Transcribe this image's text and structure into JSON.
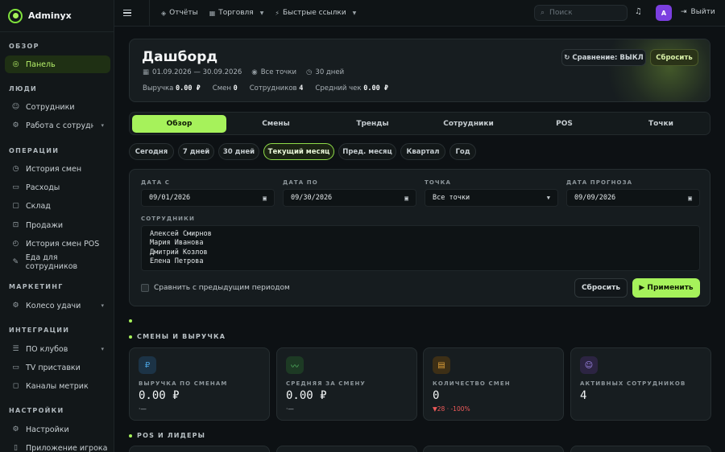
{
  "app": {
    "name": "Adminyx"
  },
  "sidebar": {
    "sections": [
      {
        "title": "ОБЗОР",
        "items": [
          {
            "label": "Панель",
            "icon": "dashboard-icon",
            "active": true
          }
        ]
      },
      {
        "title": "ЛЮДИ",
        "items": [
          {
            "label": "Сотрудники",
            "icon": "users-icon"
          },
          {
            "label": "Работа с сотрудниками",
            "icon": "briefcase-icon",
            "expandable": true
          }
        ]
      },
      {
        "title": "ОПЕРАЦИИ",
        "items": [
          {
            "label": "История смен",
            "icon": "clock-icon"
          },
          {
            "label": "Расходы",
            "icon": "wallet-icon"
          },
          {
            "label": "Склад",
            "icon": "box-icon"
          },
          {
            "label": "Продажи",
            "icon": "cart-icon"
          },
          {
            "label": "История смен POS",
            "icon": "history-icon"
          },
          {
            "label": "Еда для сотрудников",
            "icon": "food-icon"
          }
        ]
      },
      {
        "title": "МАРКЕТИНГ",
        "items": [
          {
            "label": "Колесо удачи",
            "icon": "wheel-icon",
            "expandable": true
          }
        ]
      },
      {
        "title": "ИНТЕГРАЦИИ",
        "items": [
          {
            "label": "ПО клубов",
            "icon": "software-icon",
            "expandable": true
          },
          {
            "label": "TV приставки",
            "icon": "tv-icon"
          },
          {
            "label": "Каналы метрик",
            "icon": "channel-icon"
          }
        ]
      },
      {
        "title": "НАСТРОЙКИ",
        "items": [
          {
            "label": "Настройки",
            "icon": "gear-icon"
          },
          {
            "label": "Приложение игрока",
            "icon": "phone-icon"
          }
        ]
      }
    ]
  },
  "topbar": {
    "links": [
      {
        "label": "Отчёты",
        "icon": "report-icon"
      },
      {
        "label": "Торговля",
        "icon": "trade-icon",
        "dropdown": true
      },
      {
        "label": "Быстрые ссылки",
        "icon": "bolt-icon",
        "dropdown": true
      }
    ],
    "search_placeholder": "Поиск",
    "avatar_letter": "A",
    "logout_label": "Выйти"
  },
  "hero": {
    "title": "Дашборд",
    "date_range": "01.09.2026 — 30.09.2026",
    "location": "Все точки",
    "duration": "30 дней",
    "stats": [
      {
        "label": "Выручка",
        "value": "0.00 ₽"
      },
      {
        "label": "Смен",
        "value": "0"
      },
      {
        "label": "Сотрудников",
        "value": "4"
      },
      {
        "label": "Средний чек",
        "value": "0.00 ₽"
      }
    ],
    "compare_label": "↻ Сравнение: ВЫКЛ",
    "reset_label": "Сбросить"
  },
  "tabs": [
    {
      "label": "Обзор",
      "active": true
    },
    {
      "label": "Смены"
    },
    {
      "label": "Тренды"
    },
    {
      "label": "Сотрудники"
    },
    {
      "label": "POS"
    },
    {
      "label": "Точки"
    }
  ],
  "periods": [
    {
      "label": "Сегодня"
    },
    {
      "label": "7 дней"
    },
    {
      "label": "30 дней"
    },
    {
      "label": "Текущий месяц",
      "active": true
    },
    {
      "label": "Пред. месяц"
    },
    {
      "label": "Квартал"
    },
    {
      "label": "Год"
    }
  ],
  "filters": {
    "date_from": {
      "label": "ДАТА С",
      "value": "09/01/2026"
    },
    "date_to": {
      "label": "ДАТА ПО",
      "value": "09/30/2026"
    },
    "point": {
      "label": "ТОЧКА",
      "value": "Все точки"
    },
    "forecast": {
      "label": "ДАТА ПРОГНОЗА",
      "value": "09/09/2026"
    },
    "employees": {
      "label": "СОТРУДНИКИ",
      "options": [
        "Алексей Смирнов",
        "Мария Иванова",
        "Дмитрий Козлов",
        "Елена Петрова"
      ]
    },
    "compare_checkbox": "Сравнить с предыдущим периодом",
    "reset_label": "Сбросить",
    "apply_label": "▶ Применить"
  },
  "section_shifts": {
    "title": "СМЕНЫ И ВЫРУЧКА"
  },
  "kpis": [
    {
      "label": "ВЫРУЧКА ПО СМЕНАМ",
      "value": "0.00 ₽",
      "delta": "·—",
      "icon": "ruble-icon",
      "color": "#4aa3e0"
    },
    {
      "label": "СРЕДНЯЯ ЗА СМЕНУ",
      "value": "0.00 ₽",
      "delta": "·—",
      "icon": "trend-icon",
      "color": "#5bc46a"
    },
    {
      "label": "КОЛИЧЕСТВО СМЕН",
      "value": "0",
      "delta": "▼28 · -100%",
      "icon": "clipboard-icon",
      "color": "#e0a13a"
    },
    {
      "label": "АКТИВНЫХ СОТРУДНИКОВ",
      "value": "4",
      "delta": "",
      "icon": "people-icon",
      "color": "#8a6ee0"
    }
  ],
  "section_pos": {
    "title": "POS И ЛИДЕРЫ"
  }
}
